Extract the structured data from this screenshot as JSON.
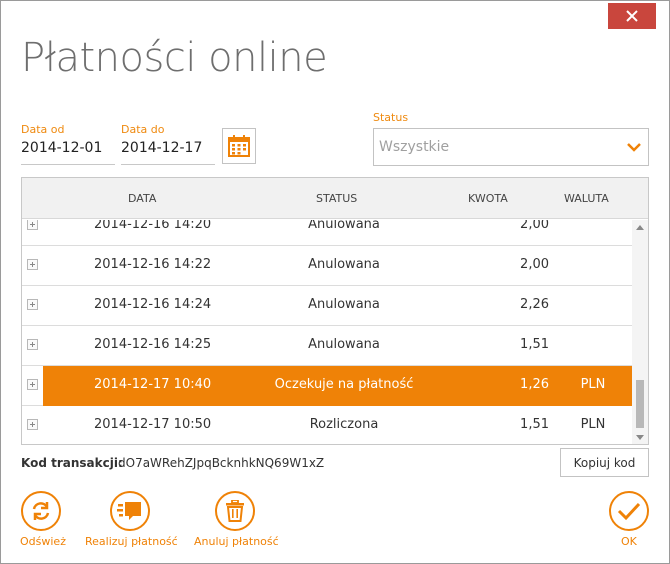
{
  "window": {
    "title": "Płatności online",
    "close_icon": "close-icon"
  },
  "filters": {
    "date_from_label": "Data od",
    "date_from_value": "2014-12-01",
    "date_to_label": "Data do",
    "date_to_value": "2014-12-17",
    "calendar_icon": "calendar-icon",
    "status_label": "Status",
    "status_value": "Wszystkie",
    "status_chevron_icon": "chevron-down-icon"
  },
  "grid": {
    "columns": [
      "DATA",
      "STATUS",
      "KWOTA",
      "WALUTA"
    ],
    "rows": [
      {
        "date": "2014-12-16 14:20",
        "status": "Anulowana",
        "amount": "2,00",
        "currency": "",
        "selected": false
      },
      {
        "date": "2014-12-16 14:22",
        "status": "Anulowana",
        "amount": "2,00",
        "currency": "",
        "selected": false
      },
      {
        "date": "2014-12-16 14:24",
        "status": "Anulowana",
        "amount": "2,26",
        "currency": "",
        "selected": false
      },
      {
        "date": "2014-12-16 14:25",
        "status": "Anulowana",
        "amount": "1,51",
        "currency": "",
        "selected": false
      },
      {
        "date": "2014-12-17 10:40",
        "status": "Oczekuje na płatność",
        "amount": "1,26",
        "currency": "PLN",
        "selected": true
      },
      {
        "date": "2014-12-17 10:50",
        "status": "Rozliczona",
        "amount": "1,51",
        "currency": "PLN",
        "selected": false
      }
    ]
  },
  "transaction": {
    "code_label": "Kod transakcji:",
    "code_value": "dO7aWRehZJpqBcknhkNQ69W1xZ",
    "copy_button": "Kopiuj kod"
  },
  "actions": {
    "refresh": "Odśwież",
    "pay": "Realizuj płatność",
    "cancel": "Anuluj płatność",
    "ok": "OK"
  },
  "colors": {
    "accent": "#ef8207",
    "close_red": "#c9463d"
  }
}
